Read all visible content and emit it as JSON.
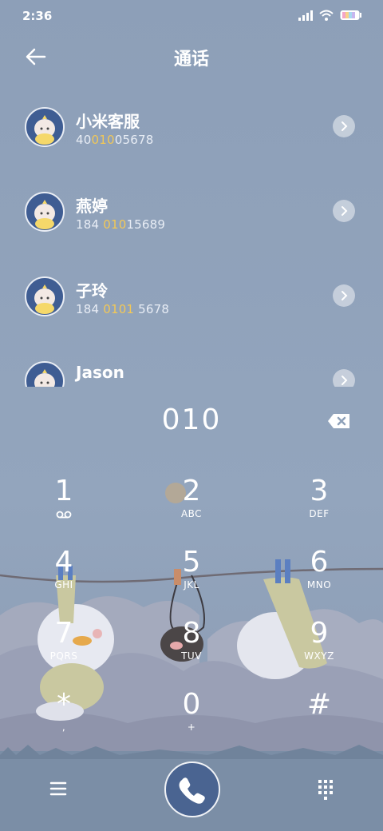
{
  "status_bar": {
    "time": "2:36",
    "icons": [
      "signal-icon",
      "wifi-icon",
      "battery-icon"
    ]
  },
  "header": {
    "title": "通话",
    "back_icon": "back-arrow-icon"
  },
  "matches": [
    {
      "name": "小米客服",
      "number_prefix": "40",
      "number_match": "010",
      "number_suffix": "05678"
    },
    {
      "name": "燕婷",
      "number_prefix": "184 ",
      "number_match": "010",
      "number_suffix": "15689"
    },
    {
      "name": "子玲",
      "number_prefix": "184 ",
      "number_match": "0101",
      "number_suffix": " 5678"
    },
    {
      "name": "Jason",
      "number_prefix": "",
      "number_match": "",
      "number_suffix": ""
    }
  ],
  "dialer": {
    "input": "010",
    "delete_icon": "backspace-icon"
  },
  "keypad": [
    {
      "digit": "1",
      "letters": ""
    },
    {
      "digit": "2",
      "letters": "ABC"
    },
    {
      "digit": "3",
      "letters": "DEF"
    },
    {
      "digit": "4",
      "letters": "GHI"
    },
    {
      "digit": "5",
      "letters": "JKL"
    },
    {
      "digit": "6",
      "letters": "MNO"
    },
    {
      "digit": "7",
      "letters": "PQRS"
    },
    {
      "digit": "8",
      "letters": "TUV"
    },
    {
      "digit": "9",
      "letters": "WXYZ"
    },
    {
      "digit": "*",
      "letters": ","
    },
    {
      "digit": "0",
      "letters": "+"
    },
    {
      "digit": "#",
      "letters": ""
    }
  ],
  "bottom_bar": {
    "menu_icon": "menu-icon",
    "call_icon": "phone-icon",
    "keypad_icon": "dialpad-icon"
  },
  "colors": {
    "background": "#8fa2ba",
    "highlight": "#f2c857",
    "call_button": "#4a6491"
  }
}
